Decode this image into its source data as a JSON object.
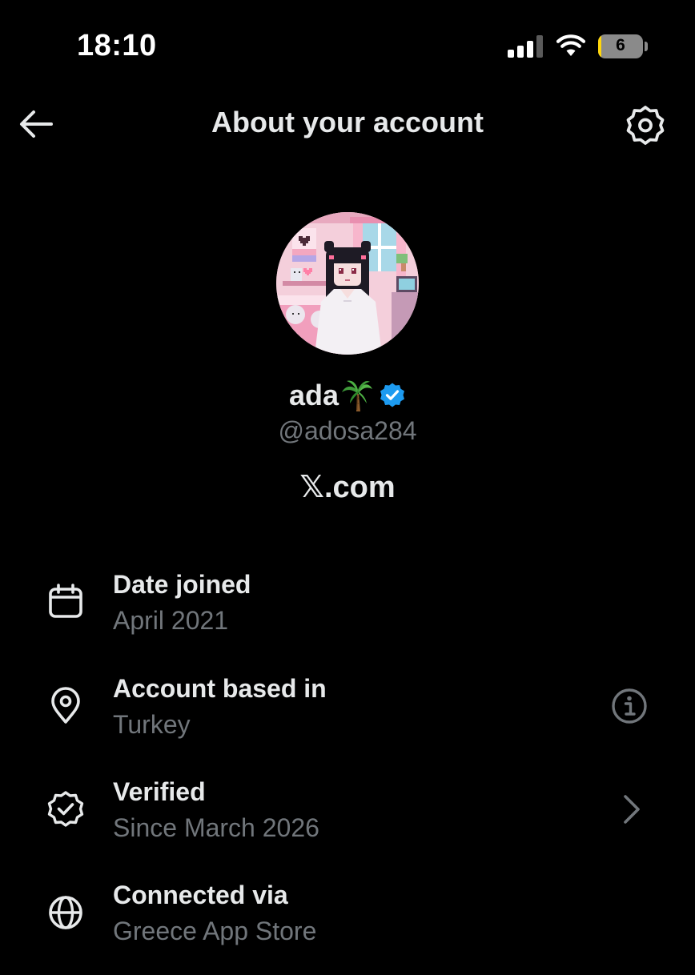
{
  "status_bar": {
    "time": "18:10",
    "signal_bars": 3,
    "signal_bars_total": 4,
    "wifi_icon": "wifi-icon",
    "battery_percent": 6,
    "battery_label": "6",
    "battery_fill_color": "#ffd60a"
  },
  "header": {
    "title": "About your account",
    "back_icon": "arrow-left-icon",
    "settings_icon": "gear-icon"
  },
  "profile": {
    "display_name": "ada",
    "name_emoji": "palm-tree-icon",
    "verified_icon": "verified-badge-icon",
    "verified_color": "#1d9bf0",
    "handle": "@adosa284",
    "platform": "𝕏.com"
  },
  "account_info": [
    {
      "icon": "calendar-icon",
      "title": "Date joined",
      "value": "April 2021",
      "action": ""
    },
    {
      "icon": "location-pin-icon",
      "title": "Account based in",
      "value": "Turkey",
      "action": "info-icon"
    },
    {
      "icon": "verified-seal-icon",
      "title": "Verified",
      "value": "Since March 2026",
      "action": "chevron-right-icon"
    },
    {
      "icon": "globe-icon",
      "title": "Connected via",
      "value": "Greece App Store",
      "action": ""
    }
  ],
  "colors": {
    "background": "#000000",
    "primary_text": "#e7e9ea",
    "secondary_text": "#71767b",
    "accent": "#1d9bf0"
  }
}
